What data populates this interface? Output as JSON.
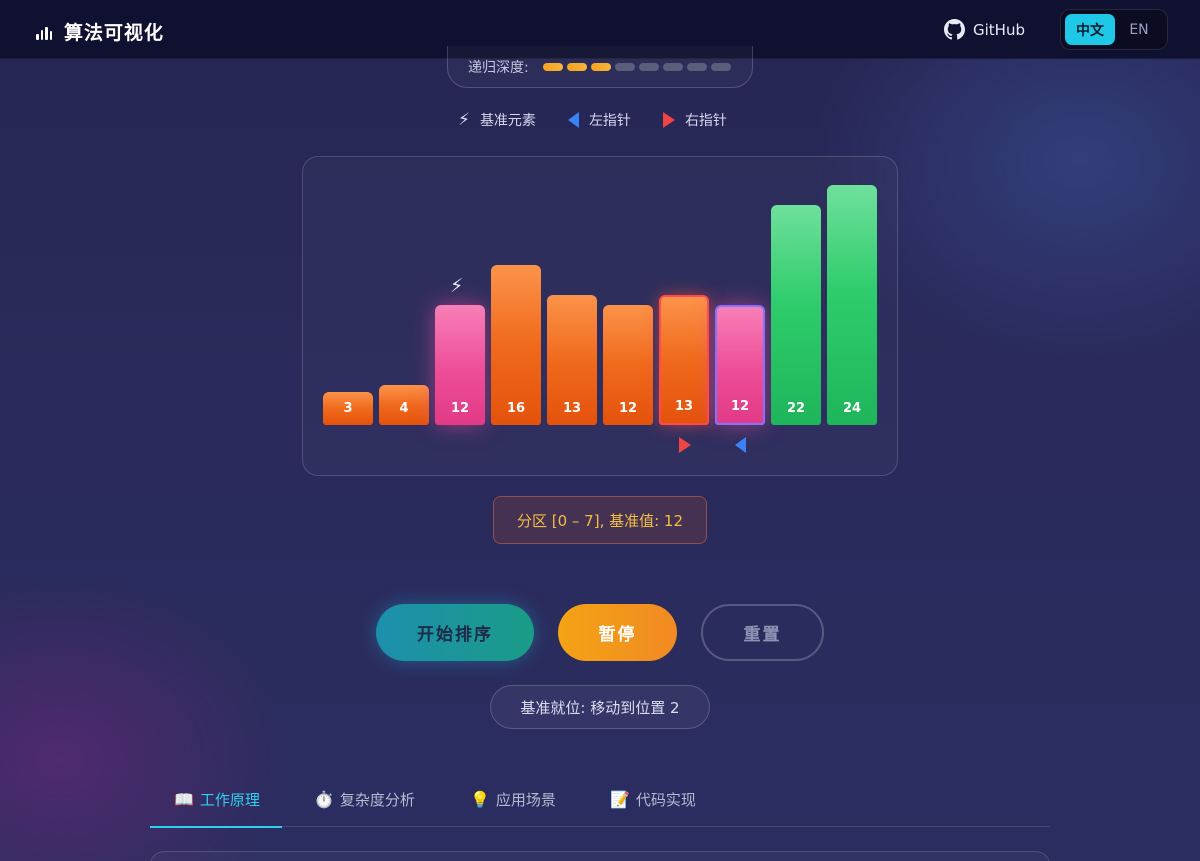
{
  "header": {
    "logo_icon": "bar-chart-icon",
    "title": "算法可视化",
    "github_label": "GitHub",
    "github_icon": "github-icon",
    "lang": {
      "zh": "中文",
      "en": "EN",
      "active": "zh"
    }
  },
  "depth": {
    "label": "递归深度:",
    "current": 3,
    "max": 8
  },
  "legend": {
    "pivot": {
      "label": "基准元素",
      "icon": "lightning-icon"
    },
    "left": {
      "label": "左指针",
      "icon": "triangle-left-icon",
      "color": "#3b82f6"
    },
    "right": {
      "label": "右指针",
      "icon": "triangle-right-icon",
      "color": "#ef4444"
    }
  },
  "chart_data": {
    "type": "bar",
    "values": [
      3,
      4,
      12,
      16,
      13,
      12,
      13,
      12,
      22,
      24
    ],
    "states": [
      "default",
      "default",
      "pivot",
      "default",
      "default",
      "default",
      "right-pointer",
      "left-pointer",
      "sorted",
      "sorted"
    ],
    "colors": {
      "default": "#f06a1c",
      "pivot": "#ee4d98",
      "sorted": "#2ecc6b",
      "right": "#ef4444",
      "left": "#3b82f6"
    },
    "pivot_index": 2,
    "right_pointer_index": 6,
    "left_pointer_index": 7
  },
  "partition_info": "分区 [0 – 7], 基准值: 12",
  "controls": {
    "start": "开始排序",
    "pause": "暂停",
    "reset": "重置"
  },
  "status": "基准就位: 移动到位置 2",
  "tabs": [
    {
      "icon": "📖",
      "label": "工作原理",
      "active": true
    },
    {
      "icon": "⏱️",
      "label": "复杂度分析",
      "active": false
    },
    {
      "icon": "💡",
      "label": "应用场景",
      "active": false
    },
    {
      "icon": "📝",
      "label": "代码实现",
      "active": false
    }
  ]
}
